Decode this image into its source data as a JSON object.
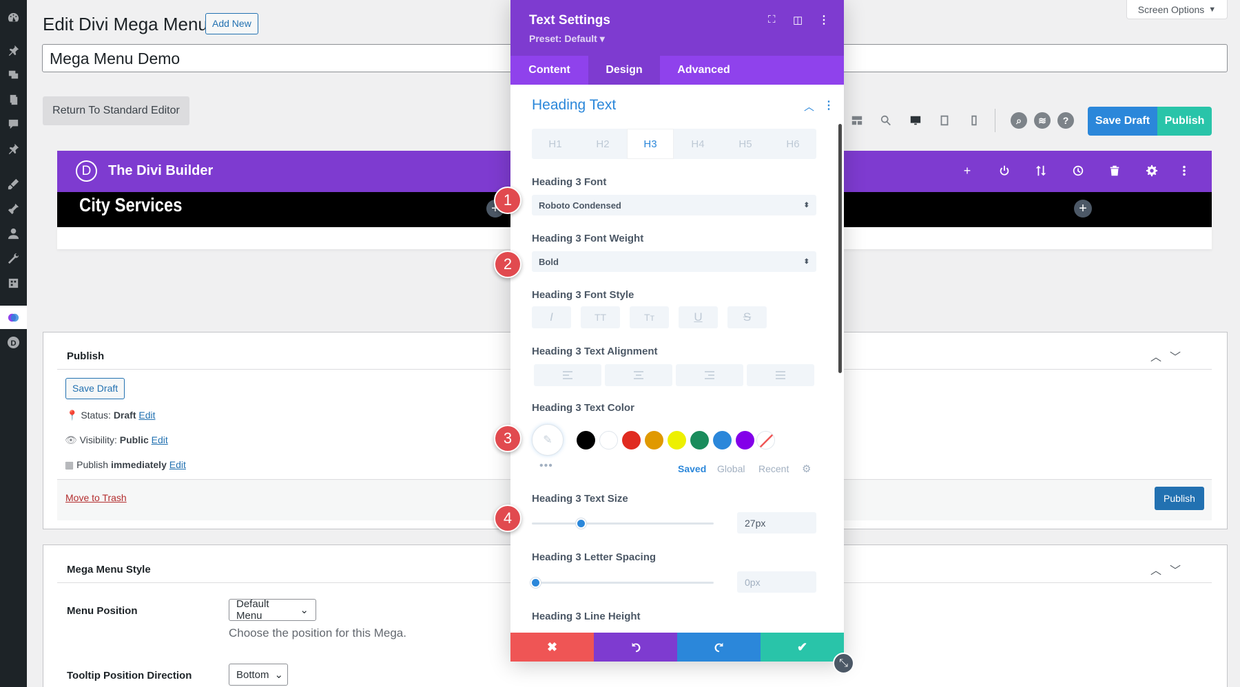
{
  "header": {
    "page_title": "Edit Divi Mega Menu",
    "add_new": "Add New",
    "post_title": "Mega Menu Demo",
    "screen_options": "Screen Options",
    "return_editor": "Return To Standard Editor"
  },
  "toolbar": {
    "save_draft": "Save Draft",
    "publish": "Publish",
    "help": "?"
  },
  "builder": {
    "logo": "D",
    "title": "The Divi Builder",
    "row_text": "City Services"
  },
  "publish_box": {
    "title": "Publish",
    "save_draft": "Save Draft",
    "status_label": "Status:",
    "status_value": "Draft",
    "visibility_label": "Visibility:",
    "visibility_value": "Public",
    "publish_label": "Publish",
    "publish_value": "immediately",
    "edit": "Edit",
    "trash": "Move to Trash",
    "publish_button": "Publish"
  },
  "mega_style": {
    "title": "Mega Menu Style",
    "menu_position_label": "Menu Position",
    "menu_position_value": "Default Menu",
    "menu_position_help": "Choose the position for this Mega.",
    "tooltip_label": "Tooltip Position Direction",
    "tooltip_value": "Bottom"
  },
  "modal": {
    "title": "Text Settings",
    "preset": "Preset: Default ▾",
    "tabs": [
      "Content",
      "Design",
      "Advanced"
    ],
    "active_tab": "Design",
    "section": "Heading Text",
    "heading_tabs": [
      "H1",
      "H2",
      "H3",
      "H4",
      "H5",
      "H6"
    ],
    "active_heading": "H3",
    "font_label": "Heading 3 Font",
    "font_value": "Roboto Condensed",
    "weight_label": "Heading 3 Font Weight",
    "weight_value": "Bold",
    "style_label": "Heading 3 Font Style",
    "align_label": "Heading 3 Text Alignment",
    "color_label": "Heading 3 Text Color",
    "color_tabs": [
      "Saved",
      "Global",
      "Recent"
    ],
    "size_label": "Heading 3 Text Size",
    "size_value": "27px",
    "size_level": 0.27,
    "spacing_label": "Heading 3 Letter Spacing",
    "spacing_value": "0px",
    "spacing_level": 0,
    "line_height_label": "Heading 3 Line Height"
  },
  "swatches": [
    "#000000",
    "#ffffff",
    "#e02b20",
    "#e09900",
    "#edf000",
    "#1a8c5c",
    "#2b87da",
    "#8300e9"
  ],
  "colors": {
    "purple": "#7e3bd0",
    "blue": "#2b87da",
    "green": "#29c4a9",
    "red": "#ef5555",
    "callout": "#e14a4f"
  },
  "callouts": [
    "1",
    "2",
    "3",
    "4"
  ]
}
